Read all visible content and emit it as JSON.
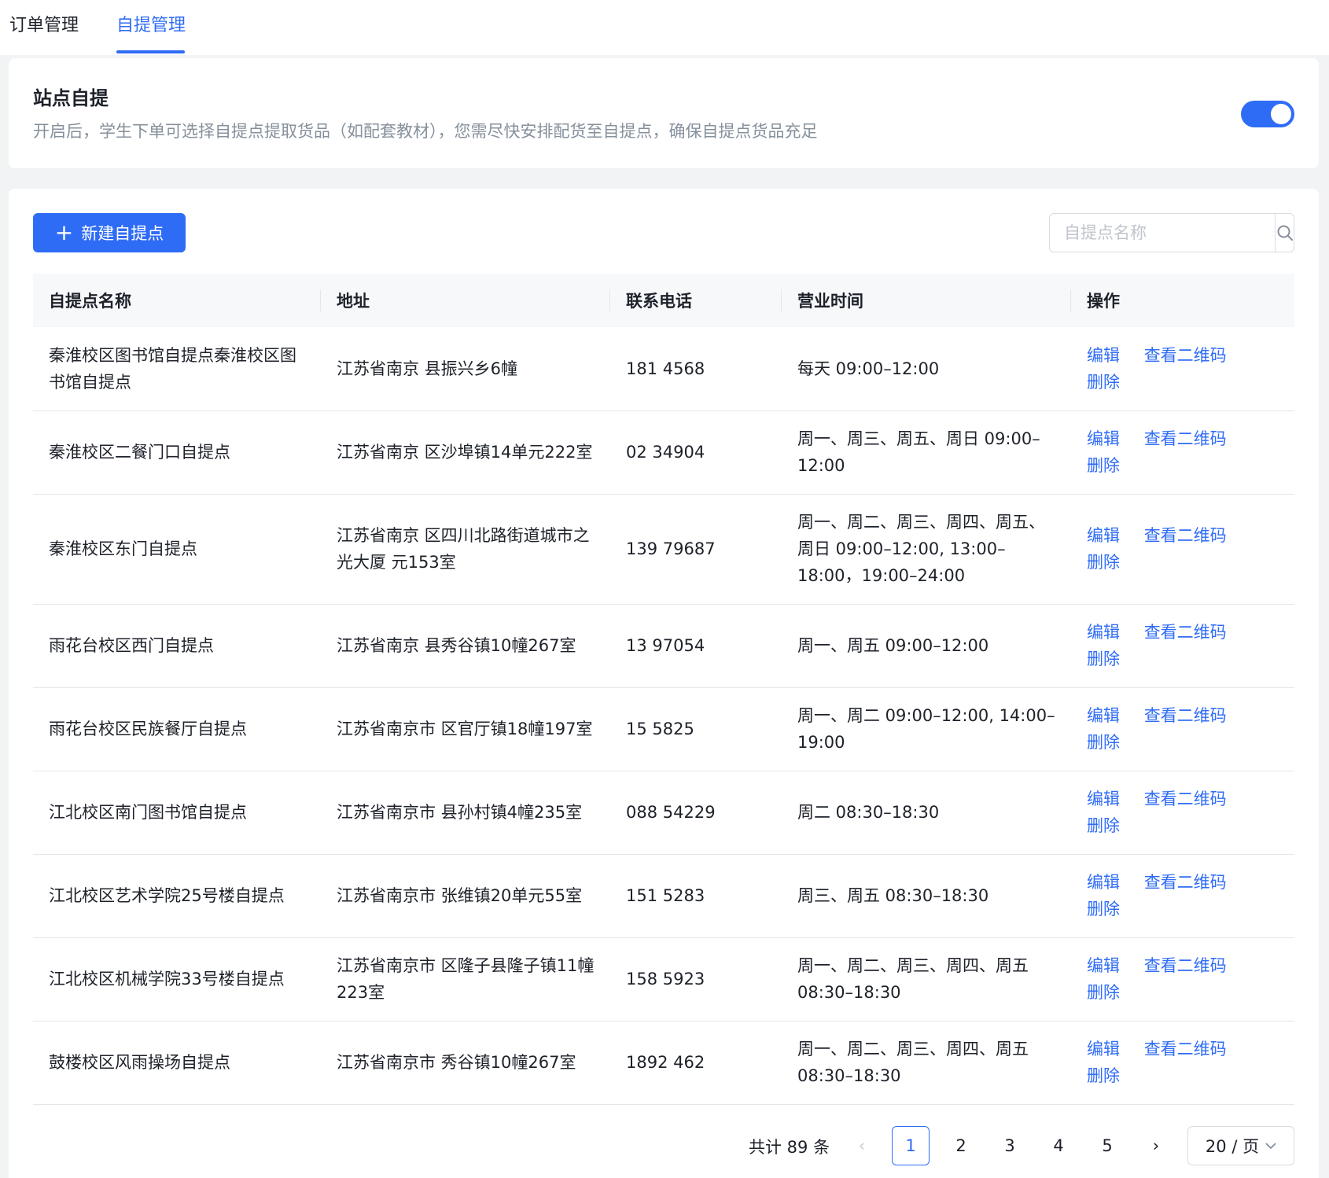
{
  "tabs": {
    "orders": "订单管理",
    "pickup": "自提管理"
  },
  "settings": {
    "title": "站点自提",
    "description": "开启后，学生下单可选择自提点提取货品（如配套教材），您需尽快安排配货至自提点，确保自提点货品充足",
    "enabled": true
  },
  "toolbar": {
    "new_button": "新建自提点",
    "search_placeholder": "自提点名称"
  },
  "table": {
    "columns": [
      "自提点名称",
      "地址",
      "联系电话",
      "营业时间",
      "操作"
    ],
    "actions": [
      "编辑",
      "查看二维码",
      "删除"
    ],
    "rows": [
      {
        "name": "秦淮校区图书馆自提点秦淮校区图书馆自提点",
        "address": "江苏省南京    县振兴乡6幢",
        "phone": "181    4568",
        "hours": "每天 09:00–12:00"
      },
      {
        "name": "秦淮校区二餐门口自提点",
        "address": "江苏省南京    区沙埠镇14单元222室",
        "phone": "02    34904",
        "hours": "周一、周三、周五、周日 09:00–12:00"
      },
      {
        "name": "秦淮校区东门自提点",
        "address": "江苏省南京    区四川北路街道城市之光大厦    元153室",
        "phone": "139    79687",
        "hours": "周一、周二、周三、周四、周五、周日 09:00–12:00, 13:00–18:00，19:00–24:00"
      },
      {
        "name": "雨花台校区西门自提点",
        "address": "江苏省南京    县秀谷镇10幢267室",
        "phone": "13    97054",
        "hours": "周一、周五 09:00–12:00"
      },
      {
        "name": "雨花台校区民族餐厅自提点",
        "address": "江苏省南京市    区官厅镇18幢197室",
        "phone": "15    5825",
        "hours": "周一、周二 09:00–12:00, 14:00–19:00"
      },
      {
        "name": "江北校区南门图书馆自提点",
        "address": "江苏省南京市    县孙村镇4幢235室",
        "phone": "088    54229",
        "hours": "周二 08:30–18:30"
      },
      {
        "name": "江北校区艺术学院25号楼自提点",
        "address": "江苏省南京市    张维镇20单元55室",
        "phone": "151    5283",
        "hours": "周三、周五 08:30–18:30"
      },
      {
        "name": "江北校区机械学院33号楼自提点",
        "address": "江苏省南京市    区隆子县隆子镇11幢223室",
        "phone": "158    5923",
        "hours": "周一、周二、周三、周四、周五 08:30–18:30"
      },
      {
        "name": "鼓楼校区风雨操场自提点",
        "address": "江苏省南京市    秀谷镇10幢267室",
        "phone": "1892    462",
        "hours": "周一、周二、周三、周四、周五 08:30–18:30"
      }
    ]
  },
  "pagination": {
    "total_text": "共计 89 条",
    "pages": [
      "1",
      "2",
      "3",
      "4",
      "5"
    ],
    "current": "1",
    "page_size": "20 / 页"
  },
  "colors": {
    "accent": "#2f6cf6",
    "muted_text": "#86909c",
    "header_bg": "#f7f8fa"
  }
}
